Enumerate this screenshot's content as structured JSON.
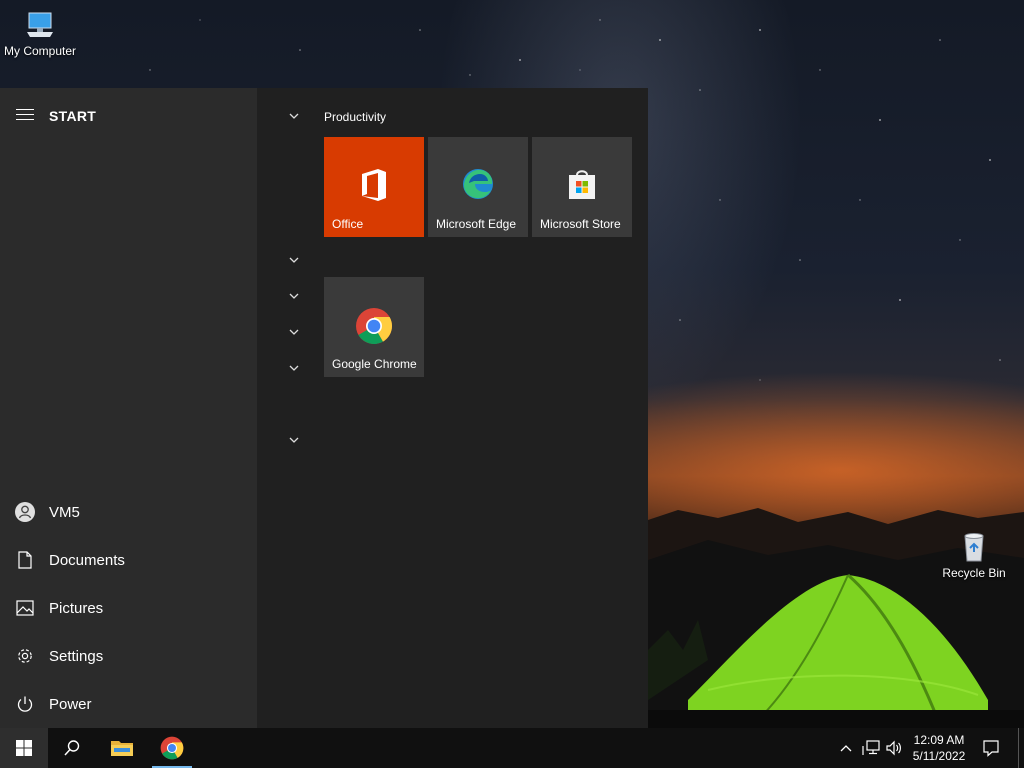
{
  "desktop": {
    "icons": [
      {
        "label": "My Computer",
        "icon": "computer-icon"
      },
      {
        "label": "Recycle Bin",
        "icon": "recycle-bin-icon"
      }
    ]
  },
  "start_menu": {
    "title": "START",
    "left_items": [
      {
        "label": "VM5",
        "icon": "user-icon"
      },
      {
        "label": "Documents",
        "icon": "document-icon"
      },
      {
        "label": "Pictures",
        "icon": "pictures-icon"
      },
      {
        "label": "Settings",
        "icon": "gear-icon"
      },
      {
        "label": "Power",
        "icon": "power-icon"
      }
    ],
    "group_title": "Productivity",
    "tiles": [
      {
        "label": "Office",
        "icon": "office-icon",
        "color": "#d83b01"
      },
      {
        "label": "Microsoft Edge",
        "icon": "edge-icon",
        "color": "#3a3a3a"
      },
      {
        "label": "Microsoft Store",
        "icon": "store-icon",
        "color": "#3a3a3a"
      },
      {
        "label": "Google Chrome",
        "icon": "chrome-icon",
        "color": "#3a3a3a"
      }
    ]
  },
  "taskbar": {
    "apps": [
      {
        "name": "Start",
        "icon": "windows-icon"
      },
      {
        "name": "Search",
        "icon": "search-icon"
      },
      {
        "name": "File Explorer",
        "icon": "folder-icon"
      },
      {
        "name": "Google Chrome",
        "icon": "chrome-icon"
      }
    ],
    "tray": [
      {
        "icon": "chevron-up-icon"
      },
      {
        "icon": "network-icon"
      },
      {
        "icon": "volume-icon"
      },
      {
        "icon": "notification-icon"
      }
    ],
    "time": "12:09 AM",
    "date": "5/11/2022"
  },
  "colors": {
    "accent": "#76b9ed",
    "office_tile": "#d83b01",
    "menu_bg": "#202020",
    "menu_left_bg": "#2b2b2b"
  }
}
